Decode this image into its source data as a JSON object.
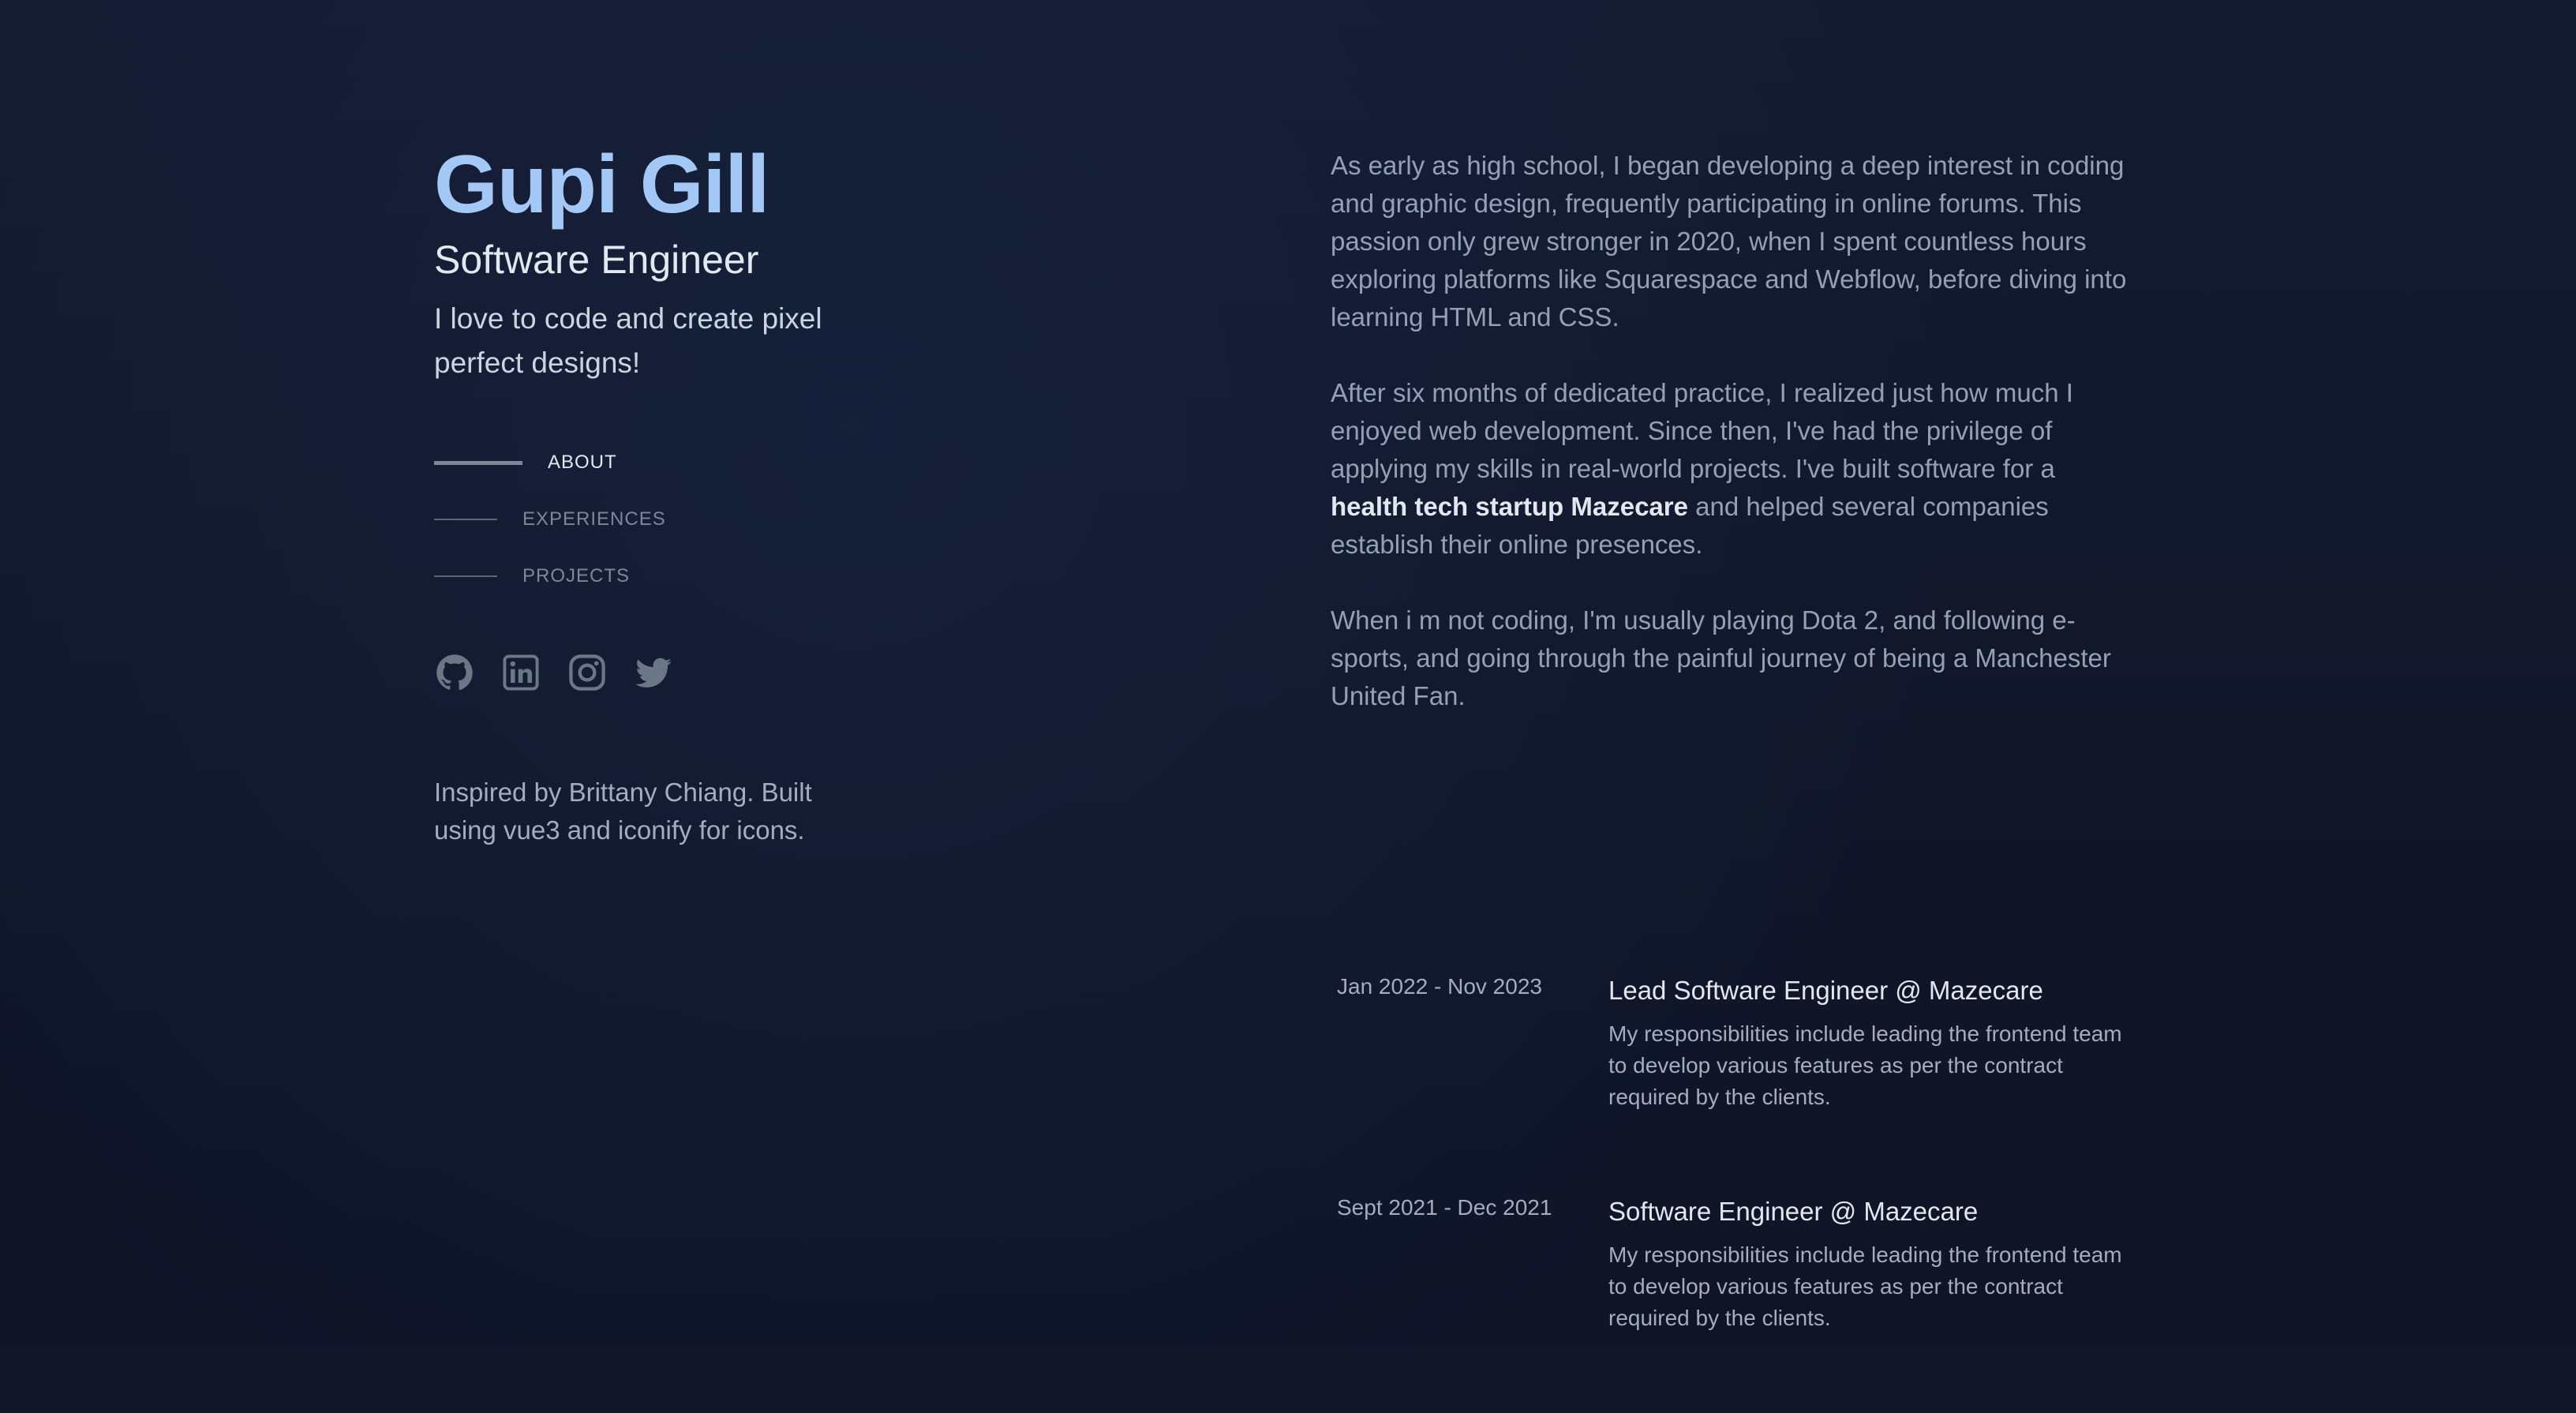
{
  "header": {
    "name": "Gupi Gill",
    "role": "Software Engineer",
    "tagline": "I love to code and create pixel perfect designs!"
  },
  "nav": {
    "items": [
      {
        "label": "ABOUT",
        "active": true
      },
      {
        "label": "EXPERIENCES",
        "active": false
      },
      {
        "label": "PROJECTS",
        "active": false
      }
    ]
  },
  "socials": [
    {
      "icon": "github-icon"
    },
    {
      "icon": "linkedin-icon"
    },
    {
      "icon": "instagram-icon"
    },
    {
      "icon": "twitter-icon"
    }
  ],
  "credit": {
    "line1": "Inspired by Brittany Chiang.",
    "line2": "Built using vue3 and iconify for icons."
  },
  "about": {
    "p1": "As early as high school, I began developing a deep interest in coding and graphic design, frequently participating in online forums. This passion only grew stronger in 2020, when I spent countless hours exploring platforms like Squarespace and Webflow, before diving into learning HTML and CSS.",
    "p2_before": "After six months of dedicated practice, I realized just how much I enjoyed web development. Since then, I've had the privilege of applying my skills in real-world projects. I've built software for a ",
    "p2_strong": "health tech startup Mazecare",
    "p2_after": " and helped several companies establish their online presences.",
    "p3": "When i m not coding, I'm usually playing Dota 2, and following e-sports, and going through the painful journey of being a Manchester United Fan."
  },
  "experiences": [
    {
      "date": "Jan 2022 - Nov 2023",
      "title": "Lead Software Engineer @ Mazecare",
      "desc": "My responsibilities include leading the frontend team to develop various features as per the contract required by the clients."
    },
    {
      "date": "Sept 2021 - Dec 2021",
      "title": "Software Engineer @ Mazecare",
      "desc": "My responsibilities include leading the frontend team to develop various features as per the contract required by the clients."
    }
  ],
  "colors": {
    "background": "#111729",
    "name_accent": "#a3c8f5",
    "heading": "#e2e8f0",
    "body_text": "#94a3b8",
    "icon": "#6b7687"
  }
}
